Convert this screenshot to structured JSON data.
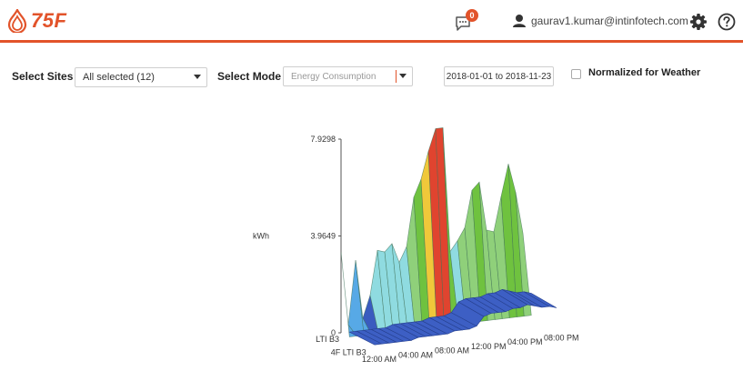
{
  "header": {
    "logo_text": "75F",
    "notification_count": "0",
    "user_email": "gaurav1.kumar@intinfotech.com",
    "accent_color": "#e2532a",
    "icons": [
      "logo-drop-icon",
      "chat-notification-icon",
      "user-icon",
      "gear-icon",
      "help-icon"
    ]
  },
  "filters": {
    "sites_label": "Select Sites",
    "sites_value": "All selected (12)",
    "mode_label": "Select Mode",
    "mode_value": "Energy Consumption",
    "date_range": "2018-01-01 to 2018-11-23",
    "normalized_label": "Normalized for Weather",
    "normalized_checked": false
  },
  "chart_data": {
    "type": "surface3d",
    "ylabel": "kWh",
    "y_ticks": [
      "7.9298",
      "3.9649",
      "0"
    ],
    "ylim": [
      0,
      7.9298
    ],
    "depth_categories": [
      "LTI B3",
      "4F LTI B3"
    ],
    "time_labels": [
      "12:00 AM",
      "04:00 AM",
      "08:00 AM",
      "12:00 PM",
      "04:00 PM",
      "08:00 PM"
    ],
    "colorscale": [
      "#3a5bbf",
      "#57a9e6",
      "#8fdbe0",
      "#8fd07a",
      "#6fc23f",
      "#f0c83a",
      "#e0442f"
    ],
    "series": [
      {
        "name": "LTI B3",
        "values": [
          3.3,
          0.3,
          2.9,
          0.5,
          1.4,
          3.2,
          3.1,
          3.4,
          2.6,
          3.2,
          5.2,
          5.9,
          7.0,
          7.9,
          7.9,
          2.8,
          3.2,
          3.7,
          5.2,
          5.5,
          3.5,
          3.4,
          4.8,
          6.1,
          4.9,
          3.2
        ]
      },
      {
        "name": "4F LTI B3",
        "values": [
          0.2,
          0.2,
          0.2,
          0.2,
          0.2,
          0.2,
          0.3,
          0.3,
          0.3,
          0.3,
          0.3,
          0.4,
          0.4,
          0.4,
          0.5,
          0.9,
          1.0,
          1.0,
          1.0,
          1.1,
          1.1,
          1.2,
          1.1,
          1.0,
          1.0,
          0.9
        ]
      }
    ]
  }
}
